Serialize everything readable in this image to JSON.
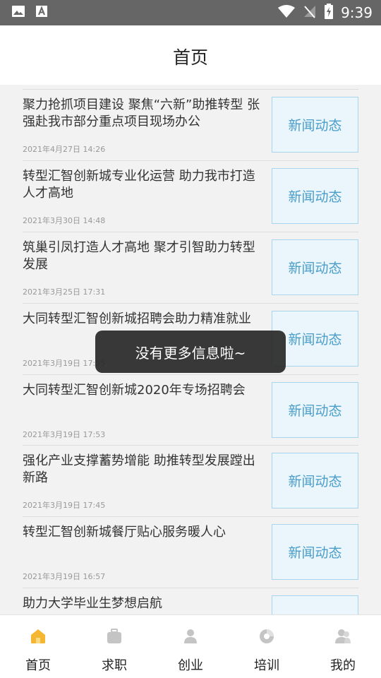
{
  "status_bar": {
    "time": "9:39",
    "left_icons": [
      "image-icon",
      "font-icon"
    ],
    "right_icons": [
      "wifi-icon",
      "signal-off-icon",
      "battery-charging-icon"
    ]
  },
  "header": {
    "title": "首页"
  },
  "news": [
    {
      "title": "聚力抢抓项目建设 聚焦“六新”助推转型 张强赴我市部分重点项目现场办公",
      "date": "2021年4月27日 14:26",
      "thumb_text": "新闻动态"
    },
    {
      "title": "转型汇智创新城专业化运营 助力我市打造人才高地",
      "date": "2021年3月30日 14:48",
      "thumb_text": "新闻动态"
    },
    {
      "title": "筑巢引凤打造人才高地 聚才引智助力转型发展",
      "date": "2021年3月25日 17:31",
      "thumb_text": "新闻动态"
    },
    {
      "title": "大同转型汇智创新城招聘会助力精准就业",
      "date": "2021年3月19日 17:55",
      "thumb_text": "新闻动态"
    },
    {
      "title": "大同转型汇智创新城2020年专场招聘会",
      "date": "2021年3月19日 17:53",
      "thumb_text": "新闻动态"
    },
    {
      "title": "强化产业支撑蓄势增能 助推转型发展蹚出新路",
      "date": "2021年3月19日 17:45",
      "thumb_text": "新闻动态"
    },
    {
      "title": "转型汇智创新城餐厅贴心服务暖人心",
      "date": "2021年3月19日 16:57",
      "thumb_text": "新闻动态"
    },
    {
      "title": "助力大学毕业生梦想启航",
      "date": "",
      "thumb_text": ""
    }
  ],
  "toast": "没有更多信息啦~",
  "tabs": [
    {
      "label": "首页",
      "icon": "home-icon",
      "active": true
    },
    {
      "label": "求职",
      "icon": "briefcase-icon",
      "active": false
    },
    {
      "label": "创业",
      "icon": "person-icon",
      "active": false
    },
    {
      "label": "培训",
      "icon": "training-icon",
      "active": false
    },
    {
      "label": "我的",
      "icon": "profile-icon",
      "active": false
    }
  ],
  "colors": {
    "accent": "#f5b731",
    "inactive_icon": "#c4c4c4",
    "thumb_text": "#4a9ec9",
    "thumb_bg": "#eaf5fc",
    "status_bar": "#666666"
  }
}
